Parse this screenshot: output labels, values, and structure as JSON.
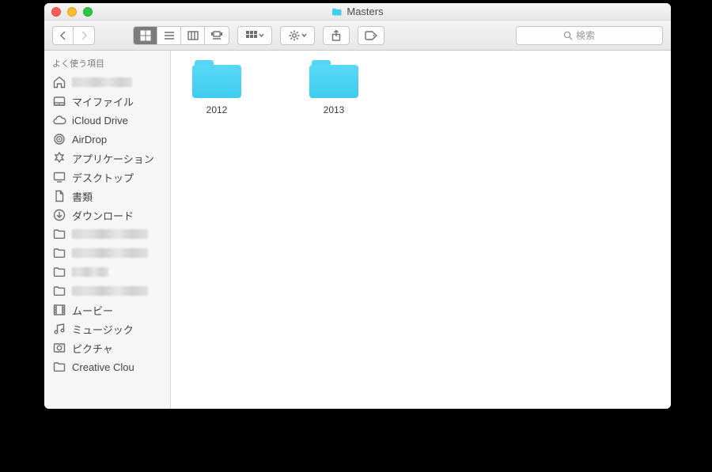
{
  "window": {
    "title": "Masters"
  },
  "toolbar": {
    "search_placeholder": "検索"
  },
  "sidebar": {
    "header": "よく使う項目",
    "items": [
      {
        "icon": "home",
        "label": "",
        "redacted": true
      },
      {
        "icon": "myfiles",
        "label": "マイファイル"
      },
      {
        "icon": "cloud",
        "label": "iCloud Drive"
      },
      {
        "icon": "airdrop",
        "label": "AirDrop"
      },
      {
        "icon": "apps",
        "label": "アプリケーション"
      },
      {
        "icon": "desktop",
        "label": "デスクトップ"
      },
      {
        "icon": "docs",
        "label": "書類"
      },
      {
        "icon": "download",
        "label": "ダウンロード"
      },
      {
        "icon": "folder",
        "label": "",
        "redacted": true,
        "len": "long"
      },
      {
        "icon": "folder",
        "label": "",
        "redacted": true,
        "len": "long"
      },
      {
        "icon": "folder",
        "label": "",
        "redacted": true,
        "len": "short"
      },
      {
        "icon": "folder",
        "label": "",
        "redacted": true,
        "len": "long"
      },
      {
        "icon": "movies",
        "label": "ムービー"
      },
      {
        "icon": "music",
        "label": "ミュージック"
      },
      {
        "icon": "pictures",
        "label": "ピクチャ"
      },
      {
        "icon": "folder",
        "label": "Creative Clou"
      }
    ]
  },
  "content": {
    "folders": [
      {
        "name": "2012"
      },
      {
        "name": "2013"
      }
    ]
  }
}
